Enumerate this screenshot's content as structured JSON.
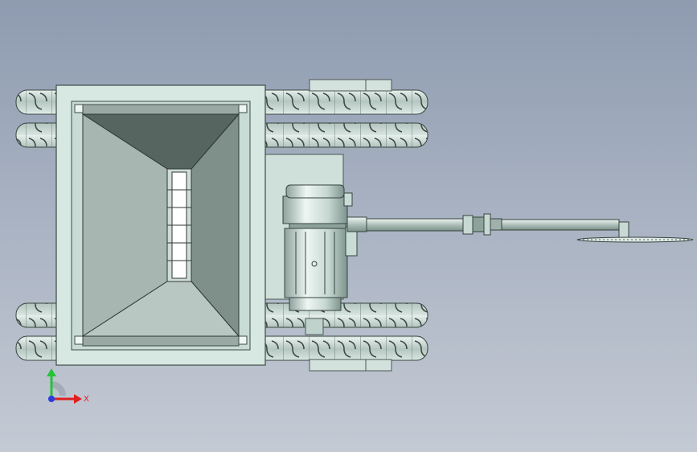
{
  "viewport": {
    "background_top": "#8e9bb0",
    "background_bottom": "#c4cad4"
  },
  "model": {
    "frame_color": "#d3e4df",
    "hopper_color": "#8f9e98",
    "track_color": "#bcccc6",
    "motor_color": "#c9dcd6",
    "arm_color": "#bfcfca"
  },
  "triad": {
    "x_label": "X",
    "x_color": "#e01f1f",
    "y_color": "#27c23a",
    "z_color": "#2a3be0",
    "icons": [
      "x-axis-arrow-icon",
      "y-axis-arrow-icon",
      "z-axis-dot-icon"
    ]
  }
}
